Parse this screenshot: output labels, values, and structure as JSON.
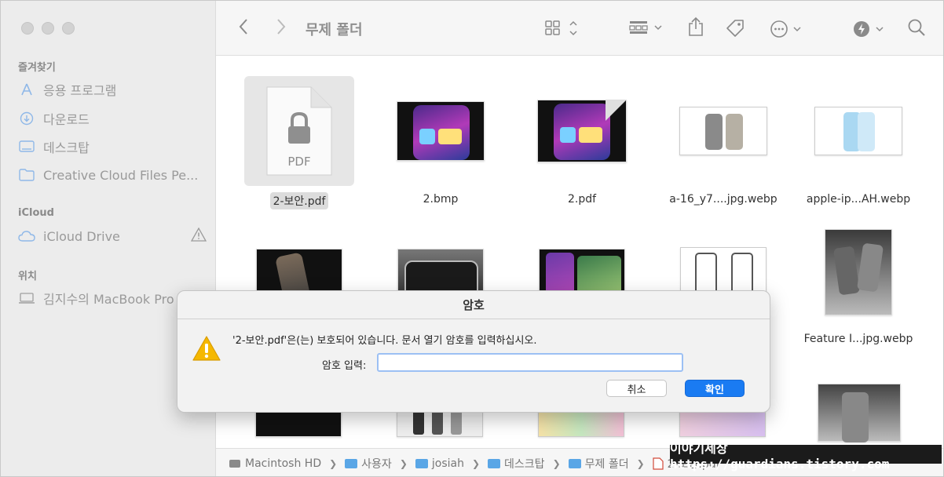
{
  "sidebar": {
    "favorites_header": "즐겨찾기",
    "favorites": [
      {
        "label": "응용 프로그램",
        "icon": "applications-icon"
      },
      {
        "label": "다운로드",
        "icon": "downloads-icon"
      },
      {
        "label": "데스크탑",
        "icon": "desktop-icon"
      },
      {
        "label": "Creative Cloud Files Pe...",
        "icon": "folder-icon"
      }
    ],
    "icloud_header": "iCloud",
    "icloud_drive": "iCloud Drive",
    "locations_header": "위치",
    "mac": "김지수의 MacBook Pro"
  },
  "toolbar": {
    "title": "무제 폴더"
  },
  "files": [
    {
      "name": "2-보안.pdf",
      "kind": "locked-pdf",
      "selected": true,
      "pdf_label": "PDF"
    },
    {
      "name": "2.bmp",
      "kind": "phone-screen"
    },
    {
      "name": "2.pdf",
      "kind": "phone-screen-pdf"
    },
    {
      "name": "a-16_y7....jpg.webp",
      "kind": "phones-white"
    },
    {
      "name": "apple-ip...AH.webp",
      "kind": "phone-blue"
    },
    {
      "name": "",
      "kind": "dark-phone"
    },
    {
      "name": "",
      "kind": "gray-phone"
    },
    {
      "name": "",
      "kind": "phone-screen"
    },
    {
      "name": "",
      "kind": "phones-outline"
    },
    {
      "name": "Feature I...jpg.webp",
      "kind": "dark-photo"
    }
  ],
  "partial_label_row2": "p",
  "pathbar": [
    "Macintosh HD",
    "사용자",
    "josiah",
    "데스크탑",
    "무제 폴더",
    "2-보안.pdf"
  ],
  "dialog": {
    "title": "암호",
    "message": "'2-보안.pdf'은(는) 보호되어 있습니다. 문서 열기 암호를 입력하십시오.",
    "password_label": "암호 입력:",
    "password_value": "",
    "cancel_label": "취소",
    "ok_label": "확인"
  },
  "watermark": "이야기세상 https://guardians.tistory.com",
  "colors": {
    "accent": "#1a7bf2",
    "warning": "#f5b800"
  }
}
